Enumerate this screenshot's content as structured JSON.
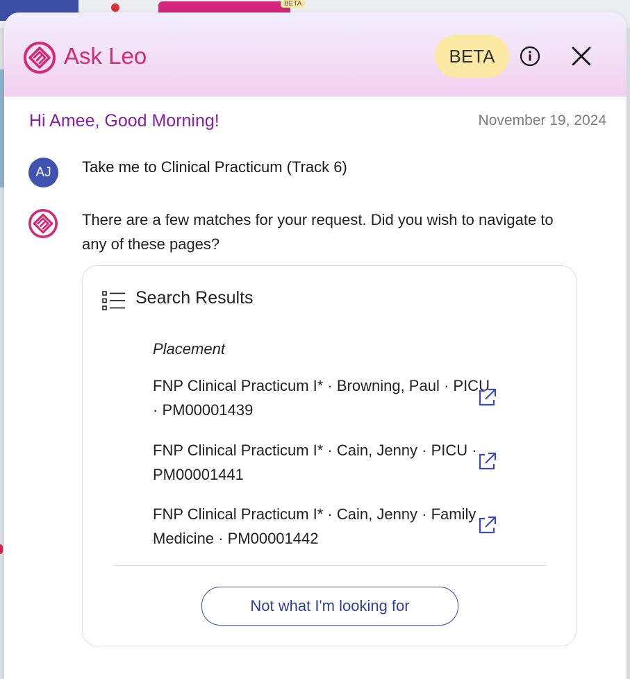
{
  "background": {
    "beta_label": "BETA"
  },
  "header": {
    "title": "Ask Leo",
    "beta_badge": "BETA",
    "info_icon": "info-icon",
    "close_icon": "close-icon"
  },
  "greeting": {
    "text": "Hi Amee, Good Morning!",
    "date": "November 19, 2024"
  },
  "conversation": {
    "user": {
      "initials": "AJ",
      "message": "Take me to Clinical Practicum (Track 6)"
    },
    "bot": {
      "message": "There are a few matches for your request. Did you wish to navigate to any of these pages?"
    }
  },
  "results": {
    "title": "Search Results",
    "icon": "list-icon",
    "group_label": "Placement",
    "items": [
      {
        "text": "FNP Clinical Practicum I*  ·  Browning, Paul  ·  PICU  ·  PM00001439"
      },
      {
        "text": "FNP Clinical Practicum I*  ·  Cain, Jenny  ·  PICU  ·  PM00001441"
      },
      {
        "text": "FNP Clinical Practicum I*  ·  Cain, Jenny  ·  Family Medicine  ·  PM00001442"
      }
    ],
    "link_icon": "external-link-icon",
    "not_found_button": "Not what I'm looking for"
  },
  "colors": {
    "brand_pink": "#d22a79",
    "greeting_purple": "#8a1fa5",
    "avatar_blue": "#3f52b0",
    "link_blue": "#3c4cb0",
    "beta_yellow": "#fbe8a3"
  }
}
